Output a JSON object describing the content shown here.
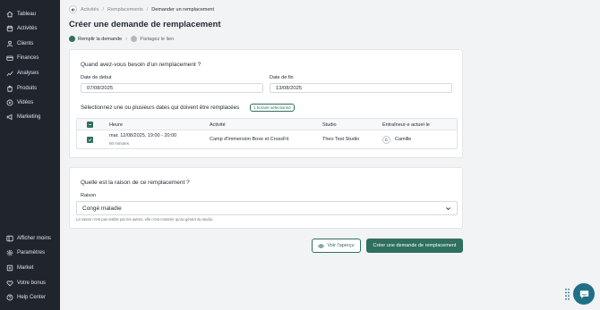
{
  "sidebar": {
    "top_items": [
      {
        "label": "Tableau",
        "icon": "home-icon"
      },
      {
        "label": "Activités",
        "icon": "activities-icon"
      },
      {
        "label": "Clients",
        "icon": "users-icon"
      },
      {
        "label": "Finances",
        "icon": "finances-icon"
      },
      {
        "label": "Analyses",
        "icon": "chart-icon"
      },
      {
        "label": "Produits",
        "icon": "products-icon"
      },
      {
        "label": "Vidéos",
        "icon": "video-icon"
      },
      {
        "label": "Marketing",
        "icon": "marketing-icon"
      }
    ],
    "bottom_items": [
      {
        "label": "Afficher moins",
        "icon": "collapse-icon"
      },
      {
        "label": "Paramètres",
        "icon": "gear-icon"
      },
      {
        "label": "Market",
        "icon": "market-icon"
      },
      {
        "label": "Votre bonus",
        "icon": "heart-icon"
      },
      {
        "label": "Help Center",
        "icon": "help-icon"
      }
    ]
  },
  "breadcrumb": {
    "items": [
      "Activités",
      "Remplacements",
      "Demander un remplacement"
    ]
  },
  "page_title": "Créer une demande de remplacement",
  "stepper": {
    "step1": "Remplir la demande",
    "step2": "Partagez le lien"
  },
  "dates_section": {
    "title": "Quand avez-vous besoin d'un remplacement ?",
    "start_label": "Date de debut",
    "start_value": "07/08/2025",
    "end_label": "Date de fin",
    "end_value": "13/08/2025",
    "select_title": "Sélectionnez une ou plusieurs dates qui doivent être remplacées",
    "selected_badge": "1 horaire sélectionné"
  },
  "table": {
    "headers": {
      "heure": "Heure",
      "activite": "Activité",
      "studio": "Studio",
      "trainer": "Entraîneur·e actuel·le"
    },
    "rows": [
      {
        "datetime": "mar. 12/08/2025, 19:00 - 20:00",
        "duration": "60 minutes",
        "activity": "Camp d'Immersion Boxe et CrossFit",
        "studio": "Theo Test Studio",
        "trainer_initial": "C",
        "trainer": "Camille"
      }
    ]
  },
  "reason_section": {
    "title": "Quelle est la raison de ce remplacement ?",
    "label": "Raison",
    "selected": "Congé maladie",
    "help": "La raison n'est pas visible par les autres, elle n'est montrée qu'au gérant du studio."
  },
  "actions": {
    "preview_label": "Voir l'aperçu",
    "submit_label": "Créer une demande de remplacement"
  },
  "colors": {
    "sidebar": "#20252d",
    "accent": "#2f6f5e",
    "chat_fab": "#1f6f86"
  }
}
